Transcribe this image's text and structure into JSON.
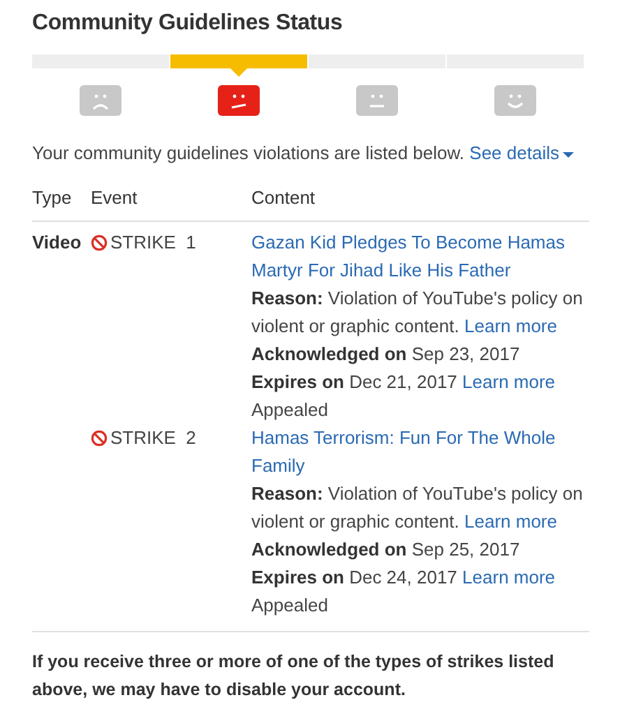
{
  "title": "Community Guidelines Status",
  "status_steps": [
    {
      "kind": "sad",
      "selected": false
    },
    {
      "kind": "worried",
      "selected": true
    },
    {
      "kind": "neutral",
      "selected": false
    },
    {
      "kind": "happy",
      "selected": false
    }
  ],
  "intro": {
    "text": "Your community guidelines violations are listed below.",
    "link": "See details"
  },
  "table": {
    "columns": [
      "Type",
      "Event",
      "Content"
    ],
    "rows": [
      {
        "type": "Video",
        "event": "STRIKE  1",
        "video_title": "Gazan Kid Pledges To Become Hamas Martyr For Jihad Like His Father",
        "reason": "**Reason:** Violation of YouTube's policy on violent or graphic content.",
        "reason_link": "Learn more",
        "acknowledged": "**Acknowledged on** Sep 23, 2017",
        "expires": "**Expires on** Dec 21, 2017",
        "expires_link": "Learn more",
        "status": "Appealed"
      },
      {
        "event": "STRIKE  2",
        "video_title": "Hamas Terrorism: Fun For The Whole Family",
        "reason": "**Reason:** Violation of YouTube's policy on violent or graphic content.",
        "reason_link": "Learn more",
        "acknowledged": "**Acknowledged on** Sep 25, 2017",
        "expires": "**Expires on** Dec 24, 2017",
        "expires_link": "Learn more",
        "status": "Appealed"
      }
    ]
  },
  "footer": "If you receive three or more of one of the types of strikes listed above, we may have to disable your account."
}
